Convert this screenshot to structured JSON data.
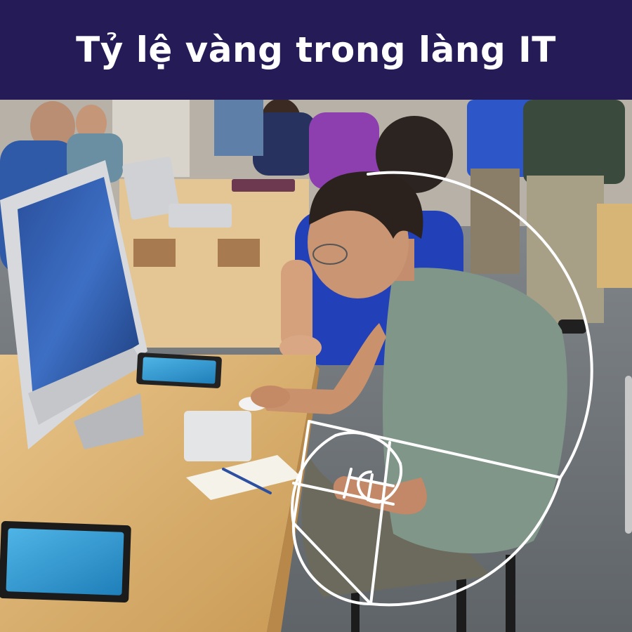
{
  "banner": {
    "title": "Tỷ lệ vàng trong làng IT",
    "background_color": "#251b57",
    "text_color": "#ffffff"
  },
  "photo": {
    "overlay_color": "#ffffff",
    "overlay_icon": "golden-spiral-icon"
  }
}
